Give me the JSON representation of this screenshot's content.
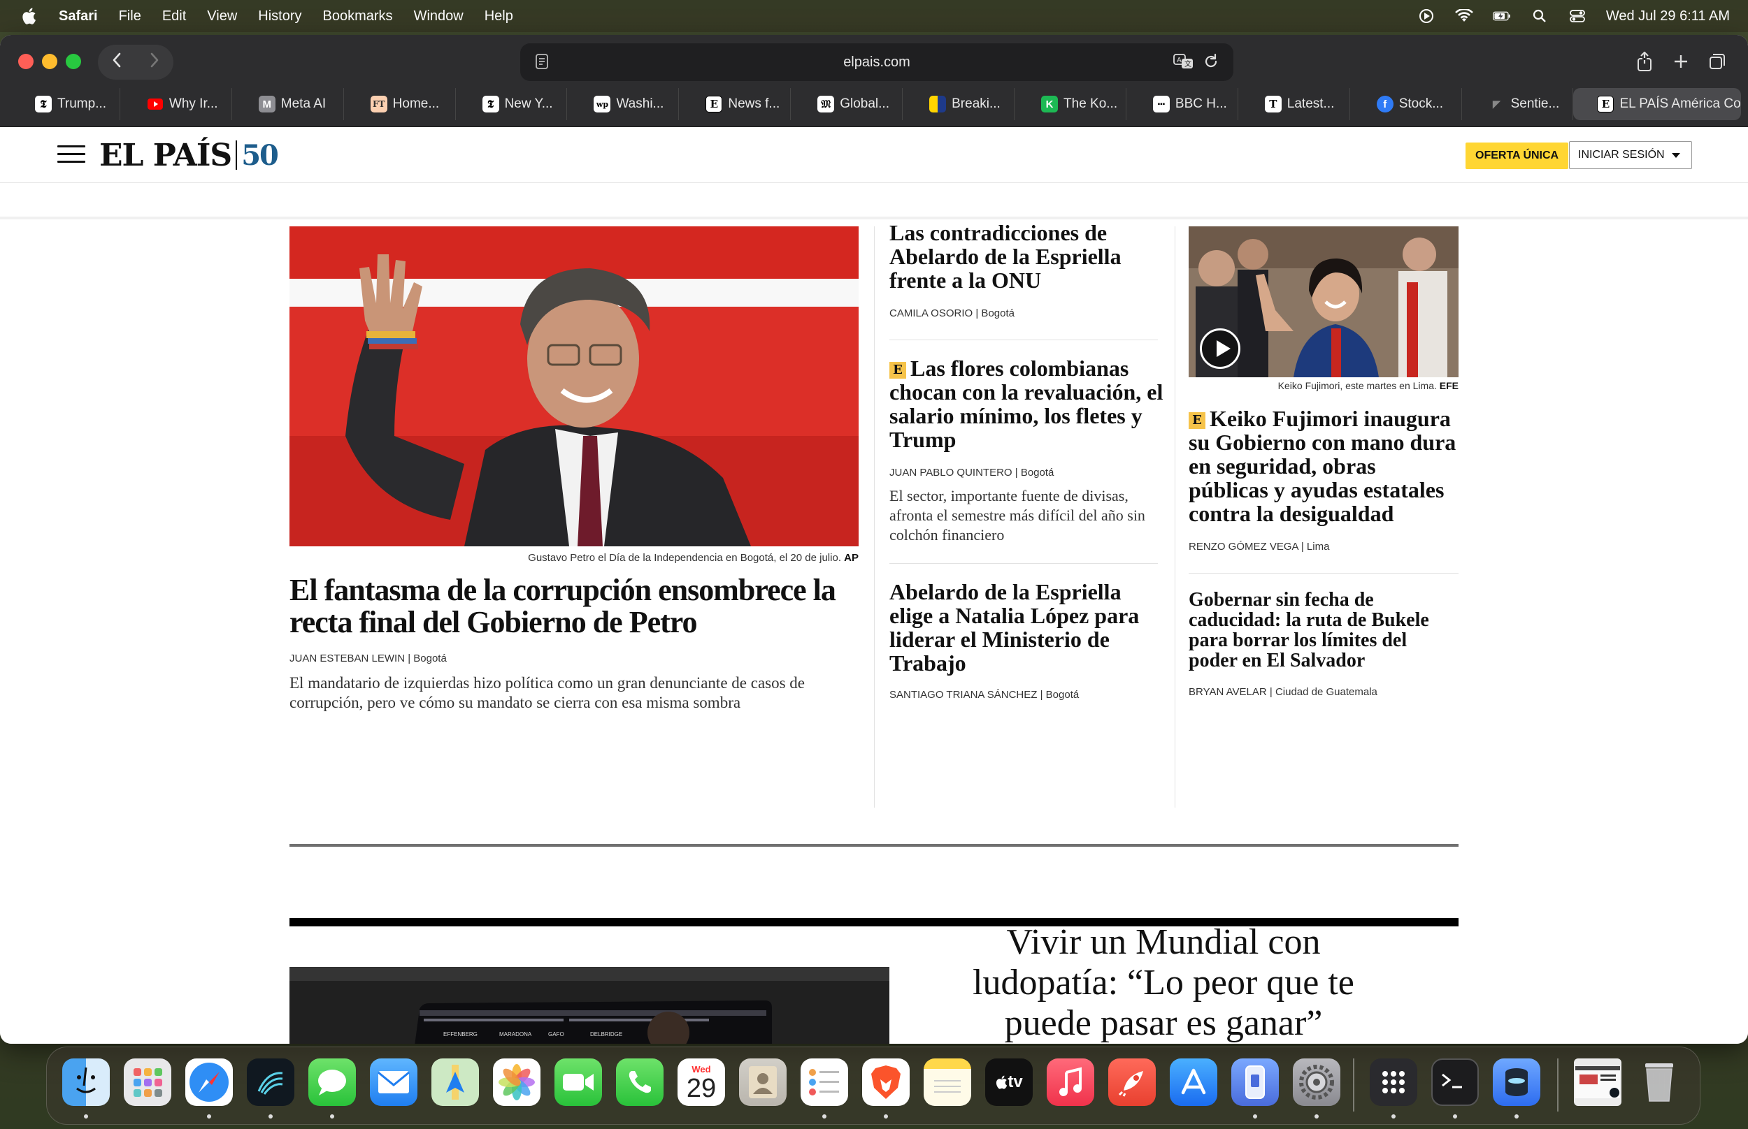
{
  "menubar": {
    "app": "Safari",
    "items": [
      "File",
      "Edit",
      "View",
      "History",
      "Bookmarks",
      "Window",
      "Help"
    ],
    "clock": "Wed Jul 29  6:11 AM"
  },
  "browser": {
    "url": "elpais.com",
    "tabs": [
      {
        "label": "Trump...",
        "icon": "nyt-icon"
      },
      {
        "label": "Why Ir...",
        "icon": "youtube-icon"
      },
      {
        "label": "Meta AI",
        "icon": "meta-ai-icon"
      },
      {
        "label": "Home...",
        "icon": "ft-icon"
      },
      {
        "label": "New Y...",
        "icon": "nyt-icon"
      },
      {
        "label": "Washi...",
        "icon": "wapo-icon"
      },
      {
        "label": "News f...",
        "icon": "news-icon"
      },
      {
        "label": "Global...",
        "icon": "global-icon"
      },
      {
        "label": "Breaki...",
        "icon": "breaking-icon"
      },
      {
        "label": "The Ko...",
        "icon": "k-icon"
      },
      {
        "label": "BBC H...",
        "icon": "bbc-icon"
      },
      {
        "label": "Latest...",
        "icon": "t-icon"
      },
      {
        "label": "Stock...",
        "icon": "stocktwits-icon"
      },
      {
        "label": "Sentie...",
        "icon": "sentient-icon"
      },
      {
        "label": "EL PAÍS América Col...",
        "icon": "elpais-icon",
        "active": true
      }
    ]
  },
  "site": {
    "logo_name": "EL PAÍS",
    "logo_anniv": "50",
    "offer_button": "OFERTA ÚNICA",
    "login_button": "INICIAR SESIÓN"
  },
  "lead": {
    "caption": "Gustavo Petro el Día de la Independencia en Bogotá, el 20 de julio.",
    "caption_credit": "AP",
    "title": "El fantasma de la corrupción ensombrece la recta final del Gobierno de Petro",
    "author": "JUAN ESTEBAN LEWIN",
    "location": " | Bogotá",
    "summary": "El mandatario de izquierdas hizo política como un gran denunciante de casos de corrupción, pero ve cómo su mandato se cierra con esa misma sombra"
  },
  "middle": [
    {
      "badge": "",
      "title": "Las contradicciones de Abelardo de la Espriella frente a la ONU",
      "author": "CAMILA OSORIO",
      "location": " | Bogotá",
      "summary": ""
    },
    {
      "badge": "E",
      "title": "Las flores colombianas chocan con la revaluación, el salario mínimo, los fletes y Trump",
      "author": "JUAN PABLO QUINTERO",
      "location": " | Bogotá",
      "summary": "El sector, importante fuente de divisas, afronta el semestre más difícil del año sin colchón financiero"
    },
    {
      "badge": "",
      "title": "Abelardo de la Espriella elige a Natalia López para liderar el Ministerio de Trabajo",
      "author": "SANTIAGO TRIANA SÁNCHEZ",
      "location": " | Bogotá",
      "summary": ""
    }
  ],
  "right": {
    "caption": "Keiko Fujimori, este martes en Lima.",
    "caption_credit": "EFE",
    "story1": {
      "badge": "E",
      "title": "Keiko Fujimori inaugura su Gobierno con mano dura en seguridad, obras públicas y ayudas estatales contra la desigualdad",
      "author": "RENZO GÓMEZ VEGA",
      "location": " | Lima"
    },
    "story2": {
      "title": "Gobernar sin fecha de caducidad: la ruta de Bukele para borrar los límites del poder en El Salvador",
      "author": "BRYAN AVELAR",
      "location": " | Ciudad de Guatemala"
    }
  },
  "feature": {
    "title": "Vivir un Mundial con ludopatía: “Lo peor que te puede pasar es ganar”",
    "screen_names": [
      "EFFENBERG",
      "MARADONA",
      "GAFO",
      "DELBRIDGE"
    ]
  },
  "dock": {
    "calendar_month": "Wed",
    "calendar_day": "29",
    "apps": [
      "Finder",
      "Launchpad",
      "Safari",
      "Perplexity",
      "Messages",
      "Mail",
      "Maps",
      "Photos",
      "FaceTime",
      "Phone",
      "Calendar",
      "Contacts",
      "Reminders",
      "Brave",
      "Notes",
      "TV",
      "Music",
      "Rocket",
      "App Store",
      "iPhone Mirroring",
      "System Settings",
      "Launchpad Grid",
      "Terminal",
      "Setapp",
      "Screenshot",
      "Trash"
    ],
    "tv_label": "tv"
  }
}
